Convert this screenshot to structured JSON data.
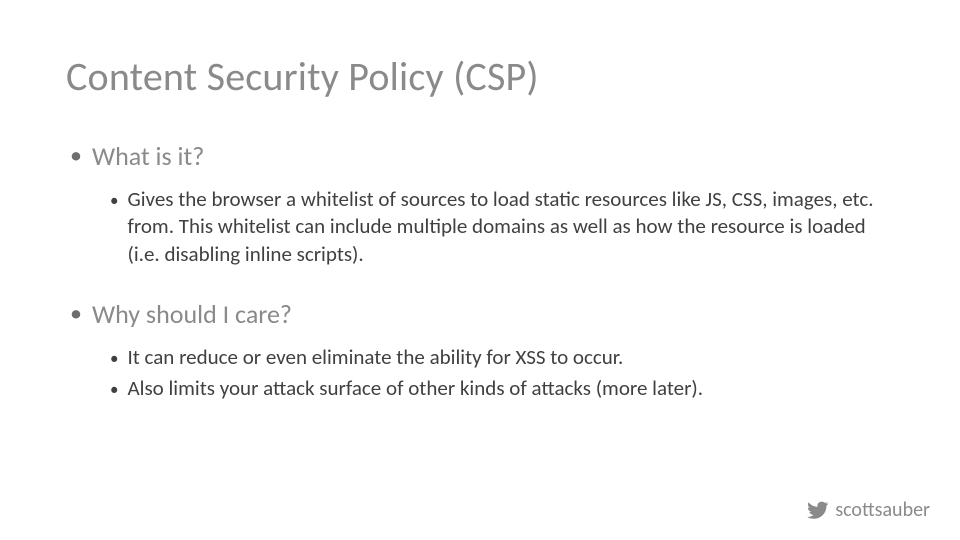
{
  "title": "Content Security Policy (CSP)",
  "sections": [
    {
      "heading": "What is it?",
      "points": [
        "Gives the browser a whitelist of sources to load static resources like JS, CSS, images, etc. from.  This whitelist can include multiple domains as well as how the resource is loaded (i.e. disabling inline scripts)."
      ]
    },
    {
      "heading": "Why should I care?",
      "points": [
        "It can reduce or even eliminate the ability for XSS to occur.",
        "Also limits your attack surface of other kinds of attacks (more later)."
      ]
    }
  ],
  "footer": {
    "handle": "scottsauber"
  }
}
